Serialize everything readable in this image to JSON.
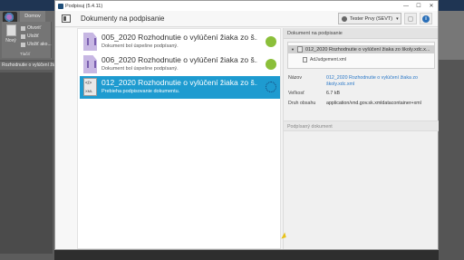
{
  "host_app": {
    "ribbon_tab": "Domov",
    "new_label": "Nový",
    "commands": [
      "Otvoriť",
      "Uložiť",
      "Uložiť ako..."
    ],
    "group_label": "Tlačiť",
    "doc_tab": "Rozhodnutie o vylúčení žiaka"
  },
  "window": {
    "title": "Podpisuj (5.4.11)",
    "controls": {
      "minimize": "—",
      "maximize": "☐",
      "close": "✕"
    }
  },
  "header": {
    "title": "Dokumenty na podpisanie",
    "user": "Tester Prvy (SEVT)",
    "user_caret": "▾",
    "info_glyph": "i"
  },
  "documents": [
    {
      "name": "005_2020 Rozhodnutie o vylúčení žiaka zo š...",
      "status": "Dokument bol úspešne podpísaný.",
      "type": "pdf",
      "state": "signed",
      "selected": false
    },
    {
      "name": "006_2020 Rozhodnutie o vylúčení žiaka zo š...",
      "status": "Dokument bol úspešne podpísaný.",
      "type": "pdf",
      "state": "signed",
      "selected": false
    },
    {
      "name": "012_2020 Rozhodnutie o vylúčení žiaka zo š...",
      "status": "Prebieha podpisovanie dokumentu.",
      "type": "xml",
      "state": "signing",
      "selected": true
    }
  ],
  "file_icon": {
    "code_glyph": "</>",
    "xml_label": "XML"
  },
  "detail": {
    "section_title": "Dokument na podpisanie",
    "tree": {
      "expand_glyph": "▼",
      "root": "012_2020 Rozhodnutie o vylúčení žiaka zo školy.xdc.x...",
      "child": "AdJudgement.xml"
    },
    "props": [
      {
        "key": "Názov",
        "value": "012_2020 Rozhodnutie o vylúčení žiaka zo školy.xdc.xml",
        "link": true
      },
      {
        "key": "Veľkosť",
        "value": "6.7 kB",
        "link": false
      },
      {
        "key": "Druh obsahu",
        "value": "application/vnd.gov.sk.xmldatacontainer+xml",
        "link": false
      }
    ],
    "signed_section_title": "Podpísaný dokument"
  },
  "colors": {
    "selected_row": "#1e9bd0",
    "signed_dot": "#8bbf3a",
    "link": "#2a78c8"
  }
}
